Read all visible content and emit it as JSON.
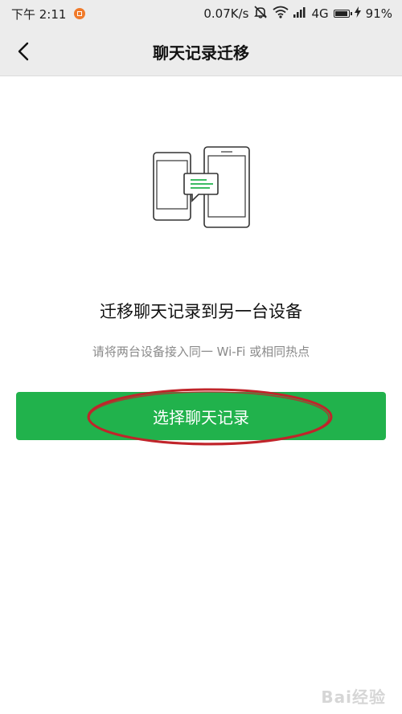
{
  "status_bar": {
    "time": "下午 2:11",
    "network_speed": "0.07K/s",
    "network_type": "4G",
    "battery": "91%",
    "icons": [
      "notification-icon",
      "mute-icon",
      "wifi-icon",
      "signal-icon",
      "battery-icon",
      "charging-icon"
    ]
  },
  "nav": {
    "title": "聊天记录迁移",
    "back_icon": "back-arrow-icon"
  },
  "main": {
    "title": "迁移聊天记录到另一台设备",
    "subtitle": "请将两台设备接入同一 Wi-Fi 或相同热点",
    "button_label": "选择聊天记录",
    "illustration": "phone-to-tablet-transfer-icon"
  },
  "watermark": {
    "text": "Bai经验"
  },
  "colors": {
    "accent_green": "#21b24c",
    "annotation_red": "#c0242a",
    "bar_gray": "#ececec",
    "subtitle_gray": "#8a8a8a"
  }
}
